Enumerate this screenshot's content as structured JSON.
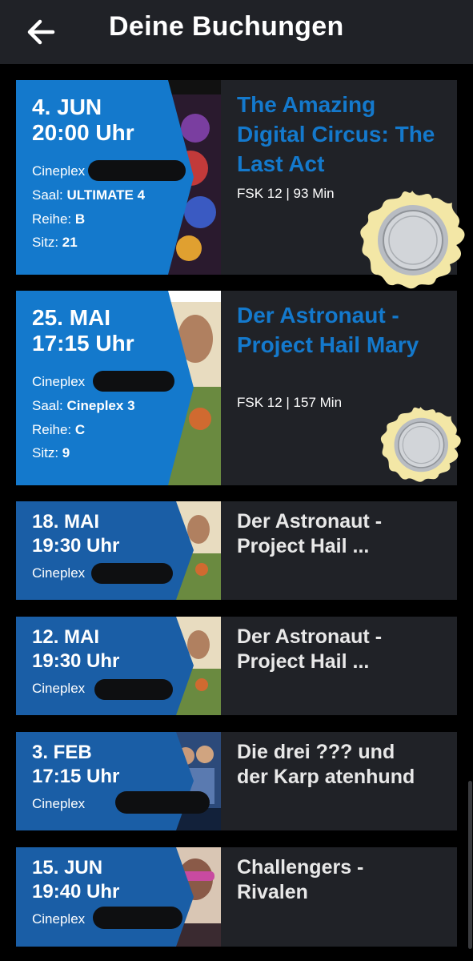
{
  "header": {
    "title": "Deine Buchungen",
    "back_icon": "arrow-left-icon"
  },
  "labels": {
    "saal": "Saal:",
    "reihe": "Reihe:",
    "sitz": "Sitz:"
  },
  "colors": {
    "accent": "#1479cc",
    "accent_dark": "#1a5ea6",
    "card_bg": "#202227",
    "header_bg": "#202227",
    "background": "#000000"
  },
  "bookings": [
    {
      "date": "4. JUN",
      "time": "20:00 Uhr",
      "cinema": "Cineplex",
      "saal": "ULTIMATE 4",
      "reihe": "B",
      "sitz": "21",
      "title": "The Amazing Digital Circus: The Last Act",
      "info": "FSK 12 | 93 Min"
    },
    {
      "date": "25. MAI",
      "time": "17:15 Uhr",
      "cinema": "Cineplex",
      "saal": "Cineplex 3",
      "reihe": "C",
      "sitz": "9",
      "title": "Der Astronaut - Project Hail Mary",
      "info": "FSK 12 | 157 Min"
    },
    {
      "date": "18. MAI",
      "time": "19:30 Uhr",
      "cinema": "Cineplex",
      "title": "Der Astronaut - Project Hail ..."
    },
    {
      "date": "12. MAI",
      "time": "19:30 Uhr",
      "cinema": "Cineplex",
      "title": "Der Astronaut - Project Hail ..."
    },
    {
      "date": "3. FEB",
      "time": "17:15 Uhr",
      "cinema": "Cineplex",
      "title": "Die drei ??? und der Karp atenhund"
    },
    {
      "date": "15. JUN",
      "time": "19:40 Uhr",
      "cinema": "Cineplex",
      "title": "Challengers - Rivalen"
    }
  ]
}
